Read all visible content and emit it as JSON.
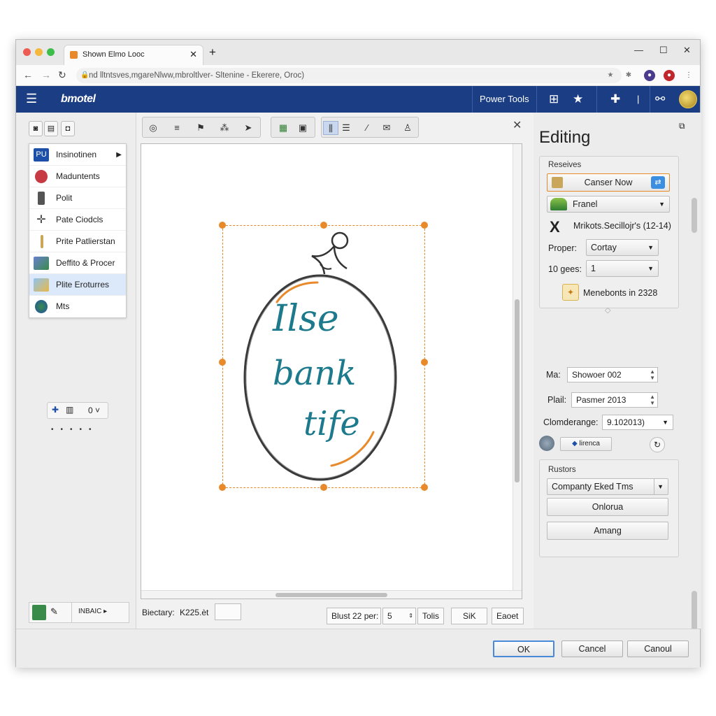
{
  "browser": {
    "tab_title": "Shown Elmo Looc",
    "url": "nd lltntsves,mgareNlww,mbroltlver- Sltenine - Ekerere, Oroc)"
  },
  "app": {
    "brand": "bmotel",
    "power_tools": "Power Tools"
  },
  "left_menu": {
    "items": [
      {
        "label": "Insinotinen",
        "icon": "pu-logo-icon",
        "has_submenu": true
      },
      {
        "label": "Maduntents",
        "icon": "bird-icon"
      },
      {
        "label": "Polit",
        "icon": "pen-icon"
      },
      {
        "label": "Pate Ciodcls",
        "icon": "crosshair-icon"
      },
      {
        "label": "Prite Patlierstan",
        "icon": "pencil-icon"
      },
      {
        "label": "Deffito & Procer",
        "icon": "landscape-icon"
      },
      {
        "label": "Plite Eroturres",
        "icon": "photo-icon",
        "highlighted": true
      },
      {
        "label": "Mts",
        "icon": "globe-icon"
      }
    ],
    "mini_value": "0",
    "bottom_label": "INBAIC"
  },
  "canvas": {
    "artwork_lines": [
      "Ilse",
      "bank",
      "tife"
    ]
  },
  "status": {
    "label": "Biectary:",
    "value": "K225.èt",
    "field_a": "Blust 22 per:",
    "field_b": "5",
    "btn_tolis": "Tolis",
    "btn_sik": "SiK",
    "btn_eaoet": "Eaoet"
  },
  "editing": {
    "title": "Editing",
    "section1": {
      "label": "Reseives",
      "btn_primary": "Canser Now",
      "select1": "Franel",
      "row_x": "Mrikots.Secillojr's (12-14)",
      "proper_label": "Proper:",
      "proper_value": "Cortay",
      "goes_label": "10 gees:",
      "goes_value": "1",
      "info": "Menebonts in 2328"
    },
    "section2": {
      "ma_label": "Ma:",
      "ma_value": "Showoer 002",
      "plail_label": "Plail:",
      "plail_value": "Pasmer 2013",
      "clom_label": "Clomderange:",
      "clom_value": "9.102013)",
      "chip": "lirenca"
    },
    "section3": {
      "label": "Rustors",
      "select": "Companty Eked Tms",
      "btn1": "Onlorua",
      "btn2": "Amang"
    }
  },
  "footer": {
    "ok": "OK",
    "cancel": "Cancel",
    "cancel2": "Canoul"
  },
  "colors": {
    "header_bg": "#1b3d84",
    "accent_orange": "#e8892a",
    "art_teal": "#1d7a8c"
  }
}
